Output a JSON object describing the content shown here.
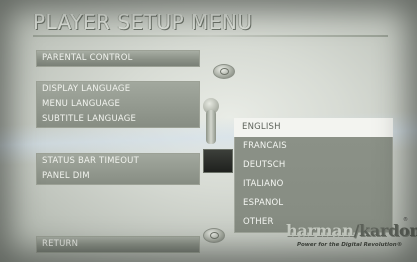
{
  "title": "PLAYER SETUP MENU",
  "menu": {
    "parental_control": "PARENTAL CONTROL",
    "language_group": [
      "DISPLAY LANGUAGE",
      "MENU LANGUAGE",
      "SUBTITLE LANGUAGE"
    ],
    "timing_group": [
      "STATUS BAR TIMEOUT",
      "PANEL DIM"
    ],
    "return": "RETURN"
  },
  "dropdown": {
    "selected": "ENGLISH",
    "options": [
      "ENGLISH",
      "FRANCAIS",
      "DEUTSCH",
      "ITALIANO",
      "ESPANOL",
      "OTHER"
    ]
  },
  "brand": {
    "name_part1": "harman",
    "separator": "/",
    "name_part2": "kardon",
    "trademark": "®",
    "tagline": "Power for the Digital Revolution®"
  }
}
